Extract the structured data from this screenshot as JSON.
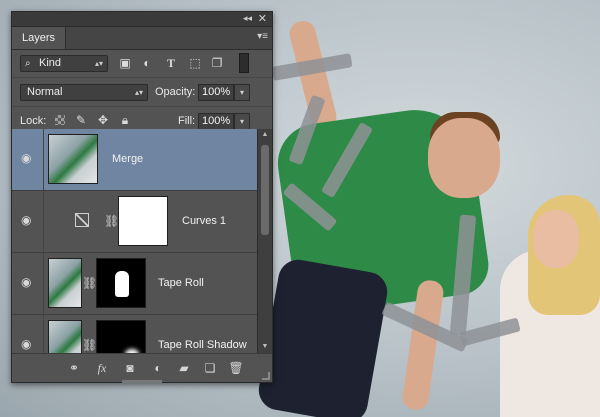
{
  "panel": {
    "titlebar": {
      "collapse_icon": "double-chevron-icon",
      "close_icon": "close-icon"
    },
    "tab_label": "Layers",
    "menu_icon": "panel-menu-icon",
    "filter": {
      "kind_value": "Kind",
      "icons": [
        "image-filter-icon",
        "adjustment-filter-icon",
        "type-filter-icon",
        "shape-filter-icon",
        "smart-object-filter-icon"
      ]
    },
    "blend": {
      "mode_value": "Normal",
      "opacity_label": "Opacity:",
      "opacity_value": "100%"
    },
    "lock": {
      "label": "Lock:",
      "fill_label": "Fill:",
      "fill_value": "100%"
    },
    "layers": [
      {
        "name": "Merge",
        "selected": true
      },
      {
        "name": "Curves 1",
        "selected": false
      },
      {
        "name": "Tape Roll",
        "selected": false
      },
      {
        "name": "Tape Roll Shadow",
        "selected": false
      }
    ],
    "footer_icons": [
      "link-layers-icon",
      "fx-icon",
      "add-mask-icon",
      "new-adjustment-icon",
      "new-group-icon",
      "new-layer-icon",
      "delete-icon"
    ],
    "colors": {
      "panel_bg": "#535353",
      "selected_row": "#6f85a1"
    }
  }
}
